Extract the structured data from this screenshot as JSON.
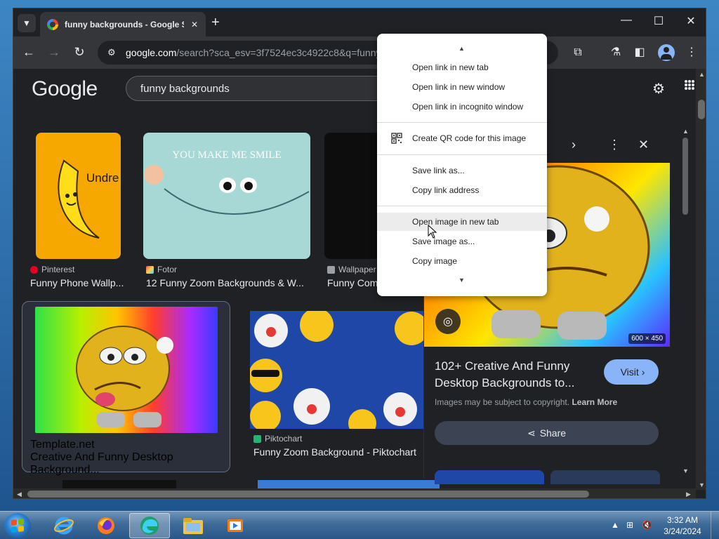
{
  "browser": {
    "tab_title": "funny backgrounds - Google S",
    "url_host": "google.com",
    "url_path": "/search?sca_esv=3f7524ec3c4922c8&q=funny+"
  },
  "google": {
    "logo": "Google",
    "query": "funny backgrounds"
  },
  "results": [
    {
      "source": "Pinterest",
      "title": "Funny Phone Wallp..."
    },
    {
      "source": "Fotor",
      "title": "12 Funny Zoom Backgrounds & W..."
    },
    {
      "source": "Wallpaper",
      "title": "Funny Com"
    },
    {
      "source": "Template.net",
      "title": "Creative And Funny Desktop Background..."
    },
    {
      "source": "Piktochart",
      "title": "Funny Zoom Background - Piktochart"
    }
  ],
  "thumb_texts": {
    "banana": "Undre",
    "smile": "YOU MAKE ME SMILE"
  },
  "panel": {
    "dimensions": "600 × 450",
    "title": "102+ Creative And Funny Desktop Backgrounds to...",
    "visit_label": "Visit",
    "copyright_text": "Images may be subject to copyright.",
    "learn_more": "Learn More",
    "share_label": "Share"
  },
  "context_menu": {
    "items": [
      "Open link in new tab",
      "Open link in new window",
      "Open link in incognito window",
      "Create QR code for this image",
      "Save link as...",
      "Copy link address",
      "Open image in new tab",
      "Save image as...",
      "Copy image"
    ]
  },
  "taskbar": {
    "time": "3:32 AM",
    "date": "3/24/2024"
  },
  "colors": {
    "accent": "#8ab4f8",
    "page_bg": "#202124",
    "toolbar_bg": "#35363a"
  }
}
